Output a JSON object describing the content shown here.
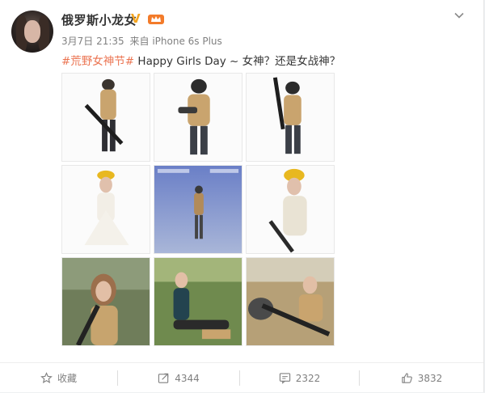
{
  "user": {
    "name": "俄罗斯小龙女",
    "verified_mark": "V",
    "badge_icon": "vip-crown-icon"
  },
  "meta": {
    "date": "3月7日 21:35",
    "source": "来自 iPhone 6s Plus"
  },
  "post": {
    "hashtag": "#荒野女神节#",
    "text": " Happy Girls Day ~ 女神？还是女战神？"
  },
  "images": [
    {
      "alt_icon": "photo-soldier-rifle-1"
    },
    {
      "alt_icon": "photo-soldier-helmet-2"
    },
    {
      "alt_icon": "photo-soldier-rifle-3"
    },
    {
      "alt_icon": "photo-girl-beret-white-dress"
    },
    {
      "alt_icon": "photo-game-screenshot"
    },
    {
      "alt_icon": "photo-girl-beret-rifle"
    },
    {
      "alt_icon": "photo-girl-field-rifle"
    },
    {
      "alt_icon": "photo-girl-sitting-grass"
    },
    {
      "alt_icon": "photo-girl-sniper-prone"
    }
  ],
  "actions": {
    "favorite_label": "收藏",
    "repost_count": "4344",
    "comment_count": "2322",
    "like_count": "3832"
  },
  "colors": {
    "link": "#eb7350",
    "verified": "#f5a623",
    "text": "#333333",
    "muted": "#808080"
  }
}
